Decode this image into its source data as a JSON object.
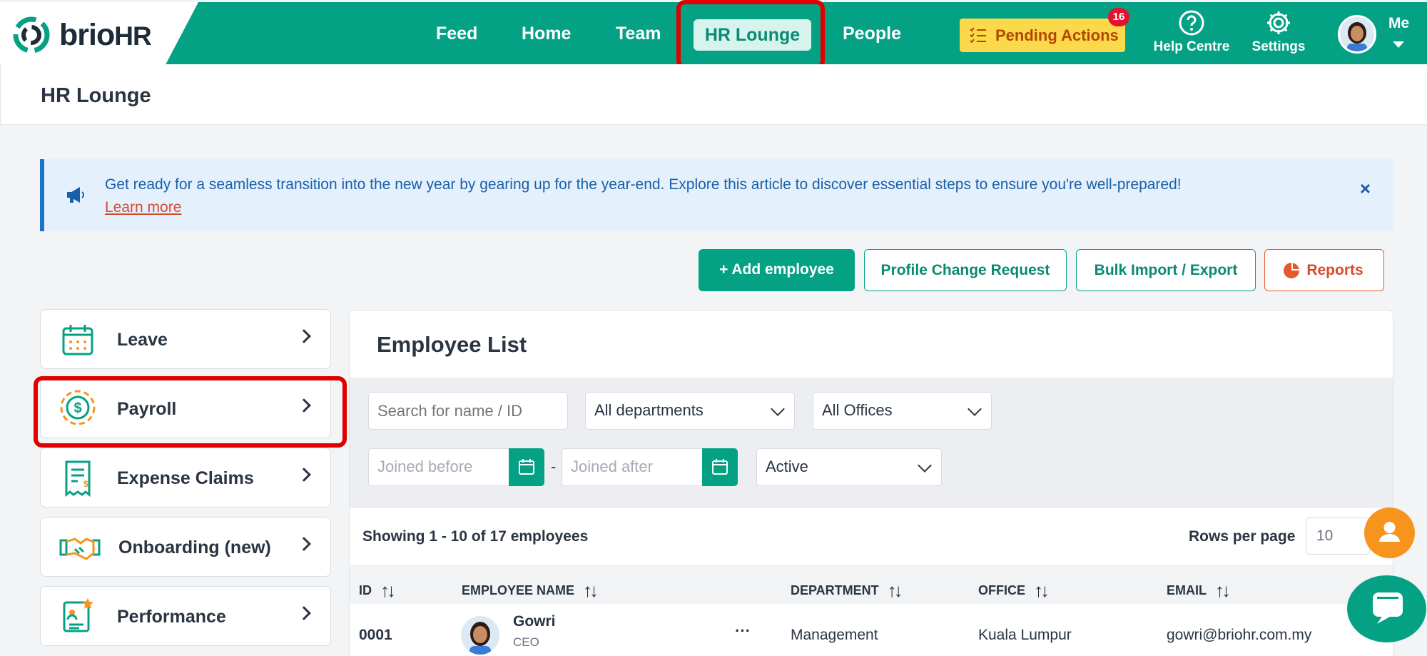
{
  "brand": {
    "name_main": "brio",
    "name_suffix": "HR"
  },
  "nav": {
    "items": [
      "Feed",
      "Home",
      "Team",
      "HR Lounge",
      "People"
    ],
    "active": "HR Lounge"
  },
  "header": {
    "pending_label": "Pending Actions",
    "pending_count": "16",
    "help_label": "Help Centre",
    "settings_label": "Settings",
    "me_label": "Me"
  },
  "page": {
    "title": "HR Lounge"
  },
  "banner": {
    "text": "Get ready for a seamless transition into the new year by gearing up for the year-end. Explore this article to discover essential steps to ensure you're well-prepared!",
    "link": "Learn more",
    "close": "×"
  },
  "actions": {
    "add_employee": "+ Add employee",
    "profile_change": "Profile Change Request",
    "bulk_import": "Bulk Import / Export",
    "reports": "Reports"
  },
  "sidebar": {
    "items": [
      {
        "label": "Leave"
      },
      {
        "label": "Payroll"
      },
      {
        "label": "Expense Claims"
      },
      {
        "label": "Onboarding (new)"
      },
      {
        "label": "Performance"
      }
    ]
  },
  "employee_list": {
    "title": "Employee List",
    "search_placeholder": "Search for name / ID",
    "department_select": "All departments",
    "office_select": "All Offices",
    "joined_before_placeholder": "Joined before",
    "joined_after_placeholder": "Joined after",
    "date_separator": "-",
    "status_select": "Active",
    "showing": "Showing 1 - 10 of 17 employees",
    "rows_per_page_label": "Rows per page",
    "rows_per_page_value": "10",
    "columns": [
      "ID",
      "EMPLOYEE NAME",
      "DEPARTMENT",
      "OFFICE",
      "EMAIL"
    ],
    "rows": [
      {
        "id": "0001",
        "name": "Gowri",
        "role": "CEO",
        "more": "···",
        "department": "Management",
        "office": "Kuala Lumpur",
        "email": "gowri@briohr.com.my"
      }
    ]
  },
  "colors": {
    "brand_green": "#05a185",
    "pending_yellow": "#fcd94a",
    "alert_red": "#e0142c",
    "highlight_box": "#e00000"
  }
}
